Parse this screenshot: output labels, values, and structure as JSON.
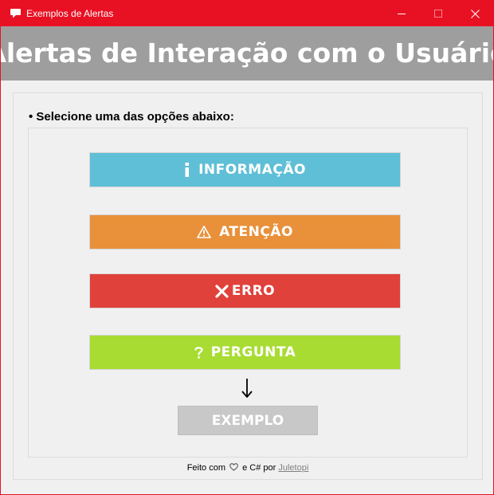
{
  "window": {
    "title": "Exemplos de Alertas",
    "icon": "speech-bubble-icon",
    "controls": {
      "minimize": "minimize-icon",
      "maximize": "maximize-icon",
      "close": "close-icon"
    },
    "accent_color": "#e81123"
  },
  "header": {
    "title": "Alertas de Interação com o Usuário",
    "background": "#9e9e9e"
  },
  "main": {
    "instruction": "• Selecione uma das opções abaixo:",
    "buttons": [
      {
        "label": "INFORMAÇÃO",
        "icon": "info-icon",
        "color": "#5fbfd6"
      },
      {
        "label": "ATENÇÃO",
        "icon": "warning-icon",
        "color": "#e8913a"
      },
      {
        "label": "ERRO",
        "icon": "error-x-icon",
        "color": "#e0413a"
      },
      {
        "label": "PERGUNTA",
        "icon": "question-icon",
        "color": "#a8dc33"
      }
    ],
    "arrow": "arrow-down-icon",
    "example_button": {
      "label": "EXEMPLO",
      "color": "#c8c8c8"
    }
  },
  "footer": {
    "prefix": "Feito com",
    "middle": "e C# por",
    "author": "Juletopi"
  }
}
